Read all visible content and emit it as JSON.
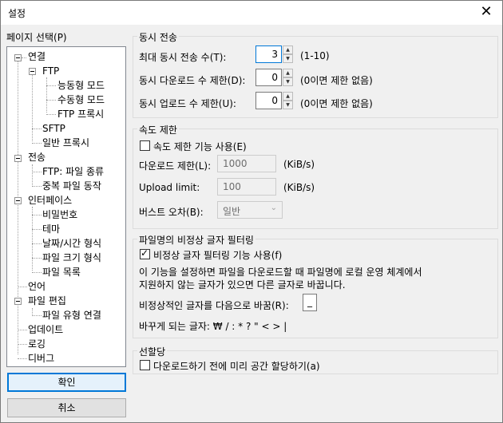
{
  "window": {
    "title": "설정",
    "close_glyph": "✕"
  },
  "tree": {
    "label": "페이지 선택(P)",
    "nodes": [
      {
        "label": "연결"
      },
      {
        "label": "FTP"
      },
      {
        "label": "능동형 모드"
      },
      {
        "label": "수동형 모드"
      },
      {
        "label": "FTP 프록시"
      },
      {
        "label": "SFTP"
      },
      {
        "label": "일반 프록시"
      },
      {
        "label": "전송"
      },
      {
        "label": "FTP: 파일 종류"
      },
      {
        "label": "중복 파일 동작"
      },
      {
        "label": "인터페이스"
      },
      {
        "label": "비밀번호"
      },
      {
        "label": "테마"
      },
      {
        "label": "날짜/시간 형식"
      },
      {
        "label": "파일 크기 형식"
      },
      {
        "label": "파일 목록"
      },
      {
        "label": "언어"
      },
      {
        "label": "파일 편집"
      },
      {
        "label": "파일 유형 연결"
      },
      {
        "label": "업데이트"
      },
      {
        "label": "로깅"
      },
      {
        "label": "디버그"
      }
    ]
  },
  "buttons": {
    "ok": "확인",
    "cancel": "취소"
  },
  "concurrent": {
    "title": "동시 전송",
    "max_label": "최대 동시 전송 수(T):",
    "max_value": "3",
    "max_hint": "(1-10)",
    "down_label": "동시 다운로드 수 제한(D):",
    "down_value": "0",
    "down_hint": "(0이면 제한 없음)",
    "up_label": "동시 업로드 수 제한(U):",
    "up_value": "0",
    "up_hint": "(0이면 제한 없음)"
  },
  "speed": {
    "title": "속도 제한",
    "enable_label": "속도 제한 기능 사용(E)",
    "enabled": false,
    "down_label": "다운로드 제한(L):",
    "down_value": "1000",
    "down_unit": "(KiB/s)",
    "up_label": "Upload limit:",
    "up_value": "100",
    "up_unit": "(KiB/s)",
    "burst_label": "버스트 오차(B):",
    "burst_value": "일반"
  },
  "filter": {
    "title": "파일명의 비정상 글자 필터링",
    "enable_label": "비정상 글자 필터링 기능 사용(f)",
    "enabled": true,
    "desc1": "이 기능을 설정하면 파일을 다운로드할 때 파일명에 로컬 운영 체계에서",
    "desc2": "지원하지 않는 글자가 있으면 다른 글자로 바꿉니다.",
    "replace_label": "비정상적인 글자를 다음으로 바꿈(R):",
    "replace_value": "_",
    "replaced_chars": "바꾸게 되는 글자: ₩ / : * ? \" < > |"
  },
  "prealloc": {
    "title": "선할당",
    "enable_label": "다운로드하기 전에 미리 공간 할당하기(a)",
    "enabled": false
  }
}
